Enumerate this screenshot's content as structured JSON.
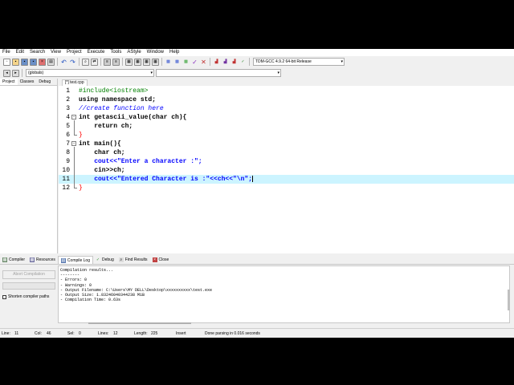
{
  "menu": [
    "File",
    "Edit",
    "Search",
    "View",
    "Project",
    "Execute",
    "Tools",
    "AStyle",
    "Window",
    "Help"
  ],
  "toolbar": {
    "compiler_select": "TDM-GCC 4.9.2 64-bit Release",
    "scope_select": "(globals)",
    "member_select": ""
  },
  "left_tabs": [
    "Project",
    "Classes",
    "Debug"
  ],
  "editor_tab": "[*] test.cpp",
  "code_lines": [
    {
      "num": "1",
      "text": "#include<iostream>"
    },
    {
      "num": "2",
      "text": "using namespace std;"
    },
    {
      "num": "3",
      "text": "//create function here"
    },
    {
      "num": "4",
      "text": "int getascii_value(char ch){"
    },
    {
      "num": "5",
      "text": "    return ch;"
    },
    {
      "num": "6",
      "text": "}"
    },
    {
      "num": "7",
      "text": "int main(){"
    },
    {
      "num": "8",
      "text": "    char ch;"
    },
    {
      "num": "9",
      "text": "    cout<<\"Enter a character :\";"
    },
    {
      "num": "10",
      "text": "    cin>>ch;"
    },
    {
      "num": "11",
      "text": "    cout<<\"Entered Character is :\"<<ch<<\"\\n\";"
    },
    {
      "num": "12",
      "text": "}"
    }
  ],
  "bottom_tabs": [
    {
      "label": "Compiler",
      "icon": "compiler-icon"
    },
    {
      "label": "Resources",
      "icon": "resources-icon"
    },
    {
      "label": "Compile Log",
      "icon": "compile-log-icon"
    },
    {
      "label": "Debug",
      "icon": "debug-icon"
    },
    {
      "label": "Find Results",
      "icon": "find-results-icon"
    },
    {
      "label": "Close",
      "icon": "close-icon"
    }
  ],
  "abort_label": "Abort Compilation",
  "shorten_label": "Shorten compiler paths",
  "log_lines": [
    "Compilation results...",
    "--------",
    "- Errors: 0",
    "- Warnings: 0",
    "- Output Filename: C:\\Users\\MY DELL\\Desktop\\xxxxxxxxxx\\test.exe",
    "- Output Size: 1.83246040344238 MiB",
    "- Compilation Time: 0.63s"
  ],
  "status": {
    "line_label": "Line:",
    "line_value": "11",
    "col_label": "Col:",
    "col_value": "46",
    "sel_label": "Sel:",
    "sel_value": "0",
    "lines_label": "Lines:",
    "lines_value": "12",
    "length_label": "Length:",
    "length_value": "225",
    "mode": "Insert",
    "message": "Done parsing in 0.016 seconds"
  }
}
